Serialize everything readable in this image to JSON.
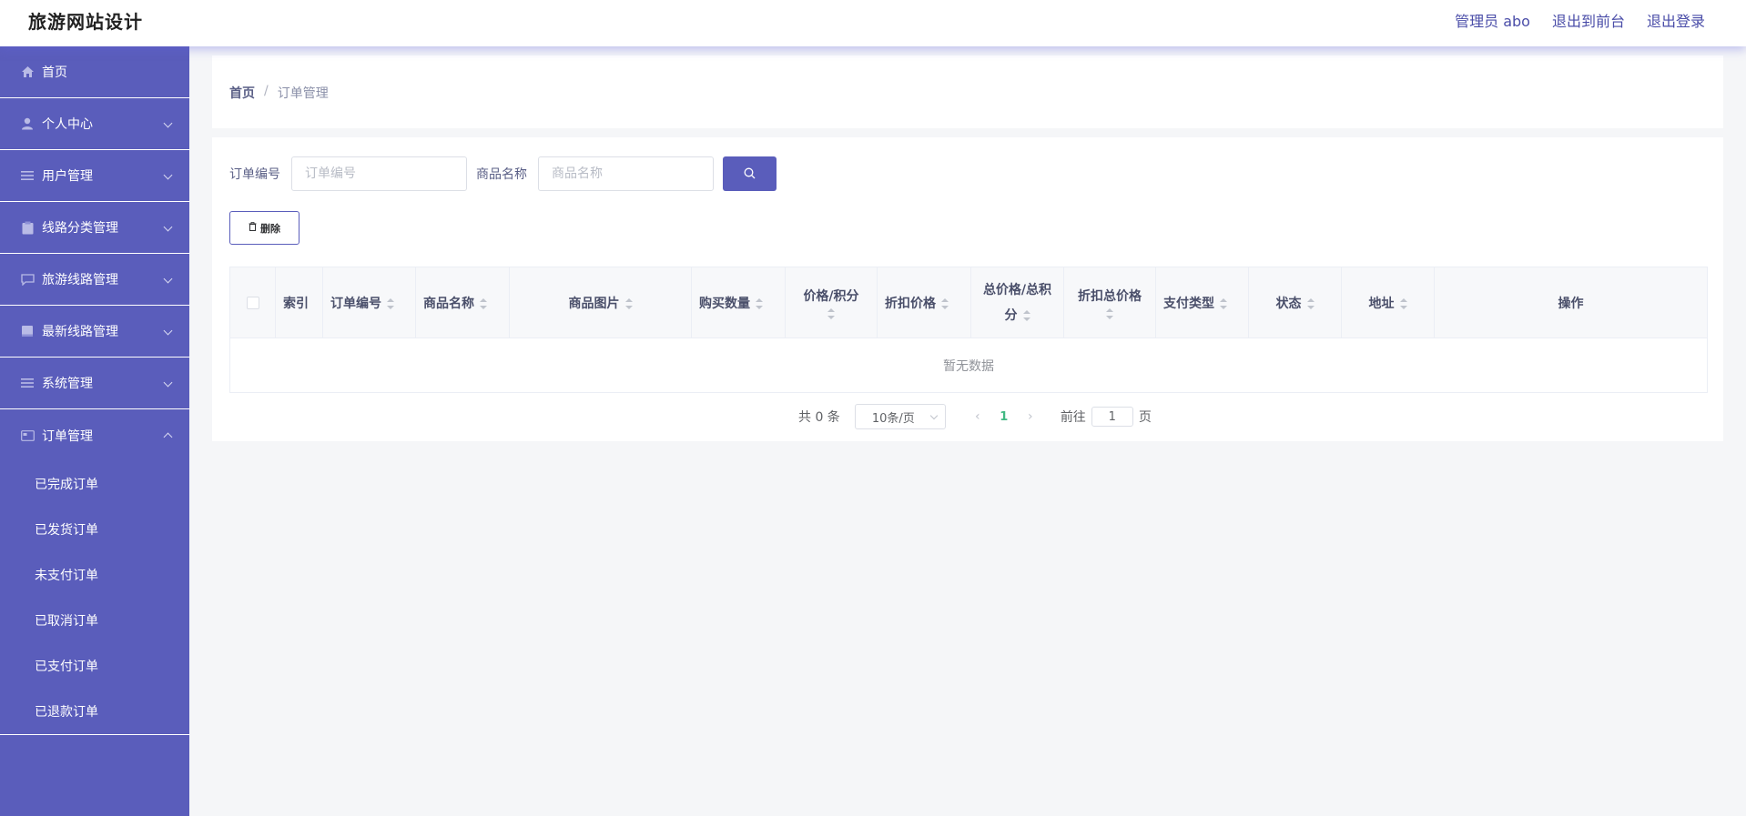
{
  "header": {
    "title": "旅游网站设计",
    "admin_label": "管理员 abo",
    "front_label": "退出到前台",
    "logout_label": "退出登录"
  },
  "sidebar": {
    "items": [
      {
        "label": "首页",
        "icon": "home-icon"
      },
      {
        "label": "个人中心",
        "icon": "user-icon"
      },
      {
        "label": "用户管理",
        "icon": "list-icon"
      },
      {
        "label": "线路分类管理",
        "icon": "clipboard-icon"
      },
      {
        "label": "旅游线路管理",
        "icon": "chat-icon"
      },
      {
        "label": "最新线路管理",
        "icon": "book-icon"
      },
      {
        "label": "系统管理",
        "icon": "list-icon"
      },
      {
        "label": "订单管理",
        "icon": "card-icon"
      }
    ],
    "sub_items": [
      "已完成订单",
      "已发货订单",
      "未支付订单",
      "已取消订单",
      "已支付订单",
      "已退款订单"
    ]
  },
  "breadcrumb": {
    "home": "首页",
    "separator": "/",
    "current": "订单管理"
  },
  "search": {
    "order_no_label": "订单编号",
    "order_no_placeholder": "订单编号",
    "product_label": "商品名称",
    "product_placeholder": "商品名称"
  },
  "actions": {
    "delete_label": "删除"
  },
  "table": {
    "columns": [
      "索引",
      "订单编号",
      "商品名称",
      "商品图片",
      "购买数量",
      "价格/积分",
      "折扣价格",
      "总价格/总积分",
      "折扣总价格",
      "支付类型",
      "状态",
      "地址",
      "操作"
    ],
    "empty_text": "暂无数据"
  },
  "pagination": {
    "total_text": "共 0 条",
    "page_size": "10条/页",
    "current_page": "1",
    "goto_label": "前往",
    "goto_value": "1",
    "page_suffix": "页"
  },
  "colors": {
    "accent": "#5a5dbb",
    "active_page": "#42b983"
  }
}
